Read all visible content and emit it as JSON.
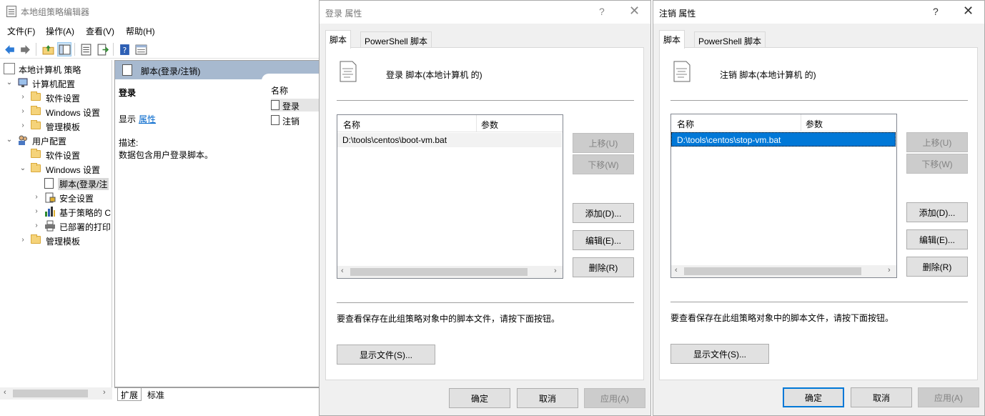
{
  "mmc": {
    "title": "本地组策略编辑器",
    "menu": [
      "文件(F)",
      "操作(A)",
      "查看(V)",
      "帮助(H)"
    ],
    "toolbar": [
      "back-arrow",
      "forward-arrow",
      "up-folder",
      "show-hide-tree",
      "export-list",
      "export",
      "help",
      "properties"
    ],
    "tree": [
      {
        "label": "本地计算机 策略",
        "indent": 0,
        "expander": "",
        "icon": "policy"
      },
      {
        "label": "计算机配置",
        "indent": 1,
        "expander": "v",
        "icon": "computer"
      },
      {
        "label": "软件设置",
        "indent": 2,
        "expander": ">",
        "icon": "folder"
      },
      {
        "label": "Windows 设置",
        "indent": 2,
        "expander": ">",
        "icon": "folder"
      },
      {
        "label": "管理模板",
        "indent": 2,
        "expander": ">",
        "icon": "folder"
      },
      {
        "label": "用户配置",
        "indent": 1,
        "expander": "v",
        "icon": "users"
      },
      {
        "label": "软件设置",
        "indent": 2,
        "expander": "",
        "icon": "folder"
      },
      {
        "label": "Windows 设置",
        "indent": 2,
        "expander": "v",
        "icon": "folder"
      },
      {
        "label": "脚本(登录/注",
        "indent": 3,
        "expander": "",
        "icon": "script",
        "selected": true
      },
      {
        "label": "安全设置",
        "indent": 3,
        "expander": ">",
        "icon": "security"
      },
      {
        "label": "基于策略的 C",
        "indent": 3,
        "expander": ">",
        "icon": "chart"
      },
      {
        "label": "已部署的打印",
        "indent": 3,
        "expander": ">",
        "icon": "printer"
      },
      {
        "label": "管理模板",
        "indent": 2,
        "expander": ">",
        "icon": "folder"
      }
    ],
    "detail": {
      "header": "脚本(登录/注销)",
      "section_title": "登录",
      "show_label": "显示",
      "properties_link": "属性",
      "description_label": "描述:",
      "description_text": "数据包含用户登录脚本。",
      "column_header": "名称",
      "items": [
        "登录",
        "注销"
      ]
    },
    "bottom_tabs": [
      "扩展",
      "标准"
    ]
  },
  "logon_dialog": {
    "title": "登录 属性",
    "help": "?",
    "close": "✕",
    "tabs": [
      "脚本",
      "PowerShell 脚本"
    ],
    "panel_title": "登录 脚本(本地计算机 的)",
    "columns": [
      "名称",
      "参数"
    ],
    "rows": [
      {
        "name": "D:\\tools\\centos\\boot-vm.bat",
        "params": ""
      }
    ],
    "buttons": {
      "up": "上移(U)",
      "down": "下移(W)",
      "add": "添加(D)...",
      "edit": "编辑(E)...",
      "delete": "删除(R)"
    },
    "hint": "要查看保存在此组策略对象中的脚本文件，请按下面按钮。",
    "show_files": "显示文件(S)...",
    "ok": "确定",
    "cancel": "取消",
    "apply": "应用(A)"
  },
  "logoff_dialog": {
    "title": "注销 属性",
    "help": "?",
    "close": "✕",
    "tabs": [
      "脚本",
      "PowerShell 脚本"
    ],
    "panel_title": "注销 脚本(本地计算机 的)",
    "columns": [
      "名称",
      "参数"
    ],
    "rows": [
      {
        "name": "D:\\tools\\centos\\stop-vm.bat",
        "params": ""
      }
    ],
    "buttons": {
      "up": "上移(U)",
      "down": "下移(W)",
      "add": "添加(D)...",
      "edit": "编辑(E)...",
      "delete": "删除(R)"
    },
    "hint": "要查看保存在此组策略对象中的脚本文件，请按下面按钮。",
    "show_files": "显示文件(S)...",
    "ok": "确定",
    "cancel": "取消",
    "apply": "应用(A)"
  },
  "colors": {
    "selection_blue": "#0078d7",
    "detail_header": "#a7b9cf",
    "link": "#0066cc",
    "dialog_bg": "#f0f0f0"
  }
}
